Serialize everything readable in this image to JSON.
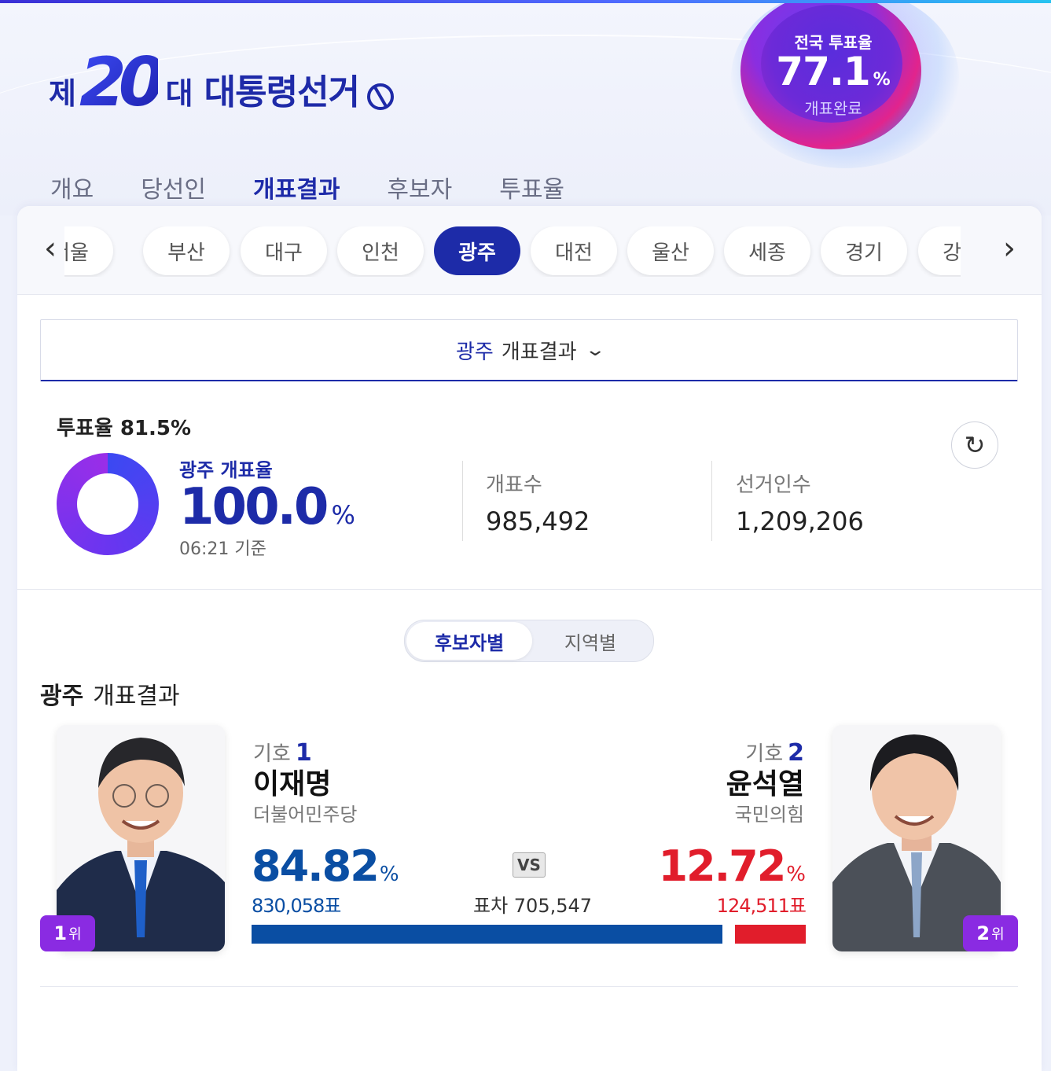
{
  "header": {
    "logo_prefix": "제",
    "logo_number": "20",
    "logo_suffix": "대",
    "logo_name": "대통령선거",
    "national_turnout_title": "전국 투표율",
    "national_turnout_value": "77.1",
    "national_turnout_unit": "%",
    "national_turnout_status": "개표완료"
  },
  "tabs": [
    {
      "label": "개요",
      "active": false
    },
    {
      "label": "당선인",
      "active": false
    },
    {
      "label": "개표결과",
      "active": true
    },
    {
      "label": "후보자",
      "active": false
    },
    {
      "label": "투표율",
      "active": false
    }
  ],
  "regions": {
    "items": [
      "서울",
      "부산",
      "대구",
      "인천",
      "광주",
      "대전",
      "울산",
      "세종",
      "경기",
      "강원"
    ],
    "selected": "광주",
    "prev_icon": "chevron-left-icon",
    "next_icon": "chevron-right-icon"
  },
  "dropdown": {
    "region": "광주",
    "label": "개표결과"
  },
  "summary": {
    "turnout_label": "투표율",
    "turnout_value": "81.5%",
    "count_rate_title": "광주 개표율",
    "count_rate_value": "100.0",
    "count_rate_unit": "%",
    "count_rate_fraction": 1.0,
    "as_of": "06:21 기준",
    "counted_label": "개표수",
    "counted_value": "985,492",
    "electorate_label": "선거인수",
    "electorate_value": "1,209,206"
  },
  "toggle": {
    "candidate_label": "후보자별",
    "region_label": "지역별",
    "selected": "후보자별"
  },
  "results": {
    "title_region": "광주",
    "title_suffix": "개표결과",
    "vs_label": "VS",
    "diff_text": "표차 705,547",
    "candidates": [
      {
        "no_label": "기호",
        "no": "1",
        "name": "이재명",
        "party": "더불어민주당",
        "pct": "84.82",
        "pct_unit": "%",
        "votes": "830,058표",
        "share": 84.82,
        "rank_num": "1",
        "rank_unit": "위",
        "color": "#0a4ea3"
      },
      {
        "no_label": "기호",
        "no": "2",
        "name": "윤석열",
        "party": "국민의힘",
        "pct": "12.72",
        "pct_unit": "%",
        "votes": "124,511표",
        "share": 12.72,
        "rank_num": "2",
        "rank_unit": "위",
        "color": "#e11d2b"
      }
    ]
  },
  "colors": {
    "brand": "#1d2ba8",
    "accent": "#8a2be2",
    "party1": "#0a4ea3",
    "party2": "#e11d2b"
  }
}
